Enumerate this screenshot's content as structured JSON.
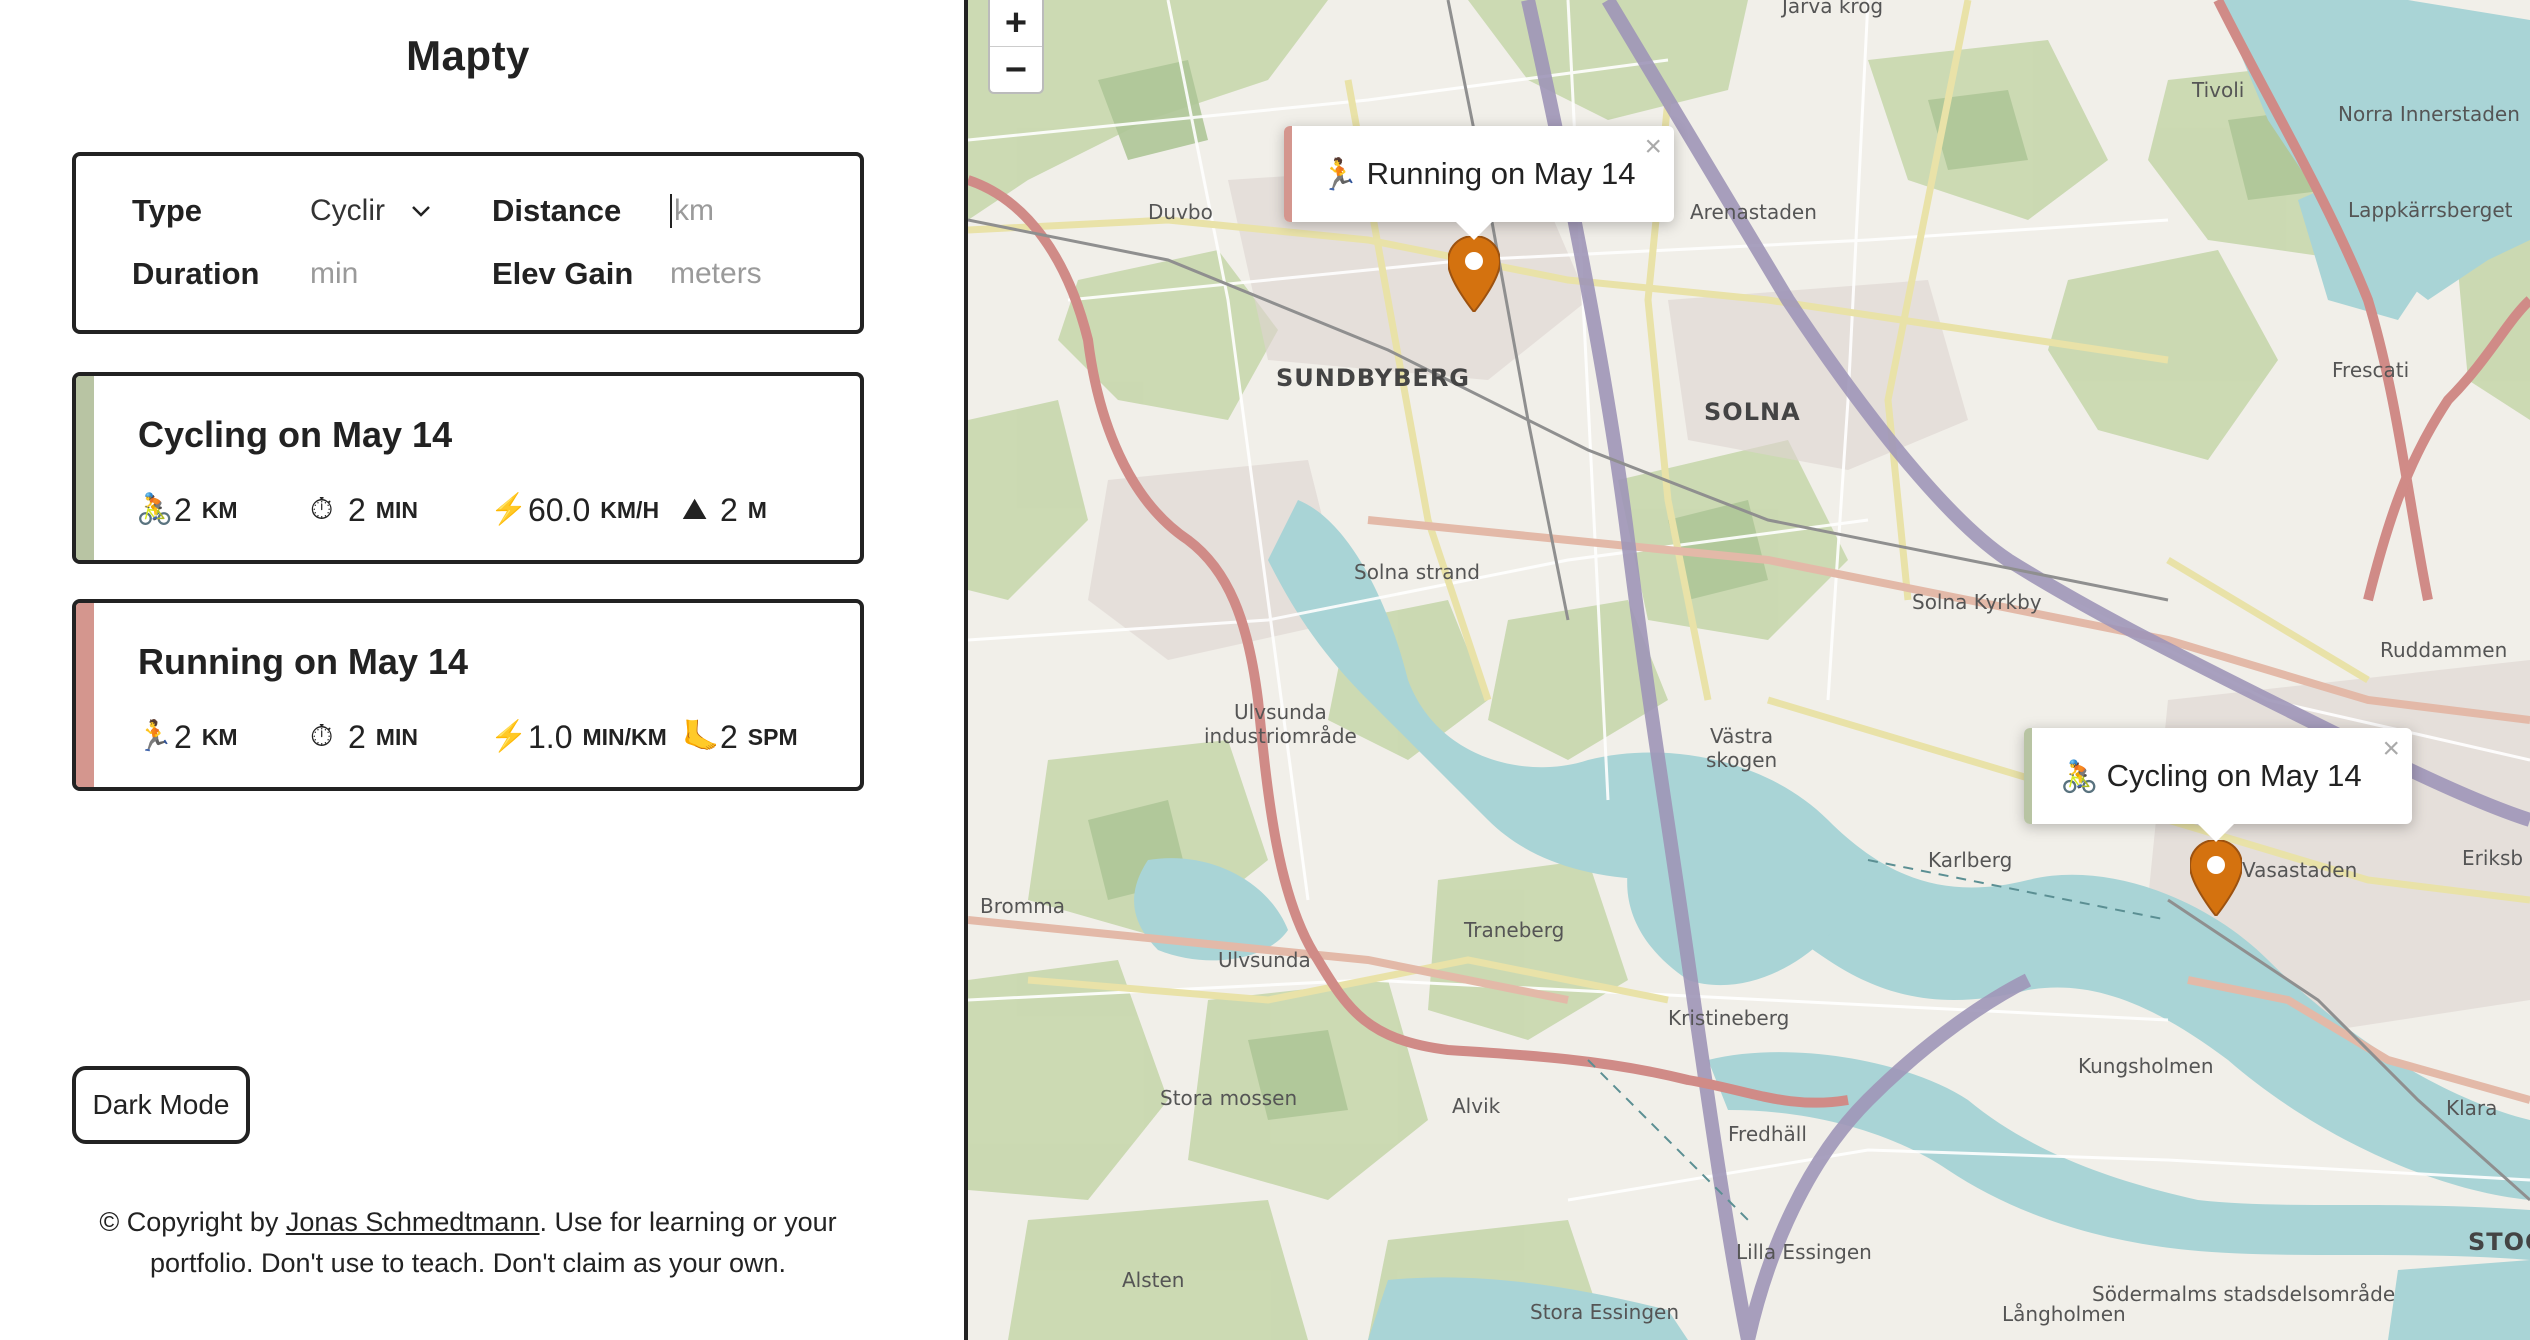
{
  "app": {
    "title": "Mapty"
  },
  "form": {
    "type_label": "Type",
    "type_value": "Cyclir",
    "distance_label": "Distance",
    "distance_placeholder": "km",
    "duration_label": "Duration",
    "duration_placeholder": "min",
    "elev_label": "Elev Gain",
    "elev_placeholder": "meters"
  },
  "workouts": [
    {
      "title": "Cycling on May 14",
      "accent": "#b8c4a3",
      "stats": [
        {
          "icon": "🚴",
          "value": "2",
          "unit": "KM"
        },
        {
          "icon": "⏱",
          "value": "2",
          "unit": "MIN"
        },
        {
          "icon": "⚡",
          "value": "60.0",
          "unit": "KM/H"
        },
        {
          "icon": "⛰",
          "value": "2",
          "unit": "M"
        }
      ]
    },
    {
      "title": "Running on May 14",
      "accent": "#d4968e",
      "stats": [
        {
          "icon": "🏃",
          "value": "2",
          "unit": "KM"
        },
        {
          "icon": "⏱",
          "value": "2",
          "unit": "MIN"
        },
        {
          "icon": "⚡",
          "value": "1.0",
          "unit": "MIN/KM"
        },
        {
          "icon": "🦶",
          "value": "2",
          "unit": "SPM"
        }
      ]
    }
  ],
  "dark_mode_label": "Dark Mode",
  "footer": {
    "prefix": "© Copyright by ",
    "author": "Jonas Schmedtmann",
    "suffix": ". Use for learning or your portfolio. Don't use to teach. Don't claim as your own."
  },
  "map": {
    "zoom_in": "+",
    "zoom_out": "−",
    "popups": {
      "running": {
        "icon": "🏃",
        "text": "Running on May 14",
        "close": "×",
        "accent": "#d4968e"
      },
      "cycling": {
        "icon": "🚴",
        "text": "Cycling on May 14",
        "close": "×",
        "accent": "#b8c4a3"
      }
    },
    "marker_color": "#d4720f",
    "labels": {
      "sundbyberg": "SUNDBYBERG",
      "solna": "SOLNA",
      "duvbo": "Duvbo",
      "arenastaden": "Arenastaden",
      "solna_strand": "Solna strand",
      "solna_kyrkby": "Solna Kyrkby",
      "ulvsunda_ind": "Ulvsunda\nindustriområde",
      "vastra_skogen": "Västra\nskogen",
      "karlberg": "Karlberg",
      "vasastaden": "Vasastaden",
      "traneberg": "Traneberg",
      "ulvsunda": "Ulvsunda",
      "bromma": "Bromma",
      "kristineberg": "Kristineberg",
      "fredhall": "Fredhäll",
      "kungsholmen": "Kungsholmen",
      "stora_mossen": "Stora mossen",
      "alvik": "Alvik",
      "alsten": "Alsten",
      "lilla_essingen": "Lilla Essingen",
      "stora_essingen": "Stora Essingen",
      "tivoli": "Tivoli",
      "frescati": "Frescati",
      "ruddammen": "Ruddammen",
      "norra_innerstaden": "Norra Innerstaden",
      "lappkarrsberget": "Lappkärrsberget",
      "klara": "Klara",
      "eriksberg": "Eriksb",
      "langholmen": "Långholmen",
      "sodermalm": "Södermalms stadsdelsområde",
      "stockholm": "STOC",
      "jarva": "Järva krog"
    }
  }
}
